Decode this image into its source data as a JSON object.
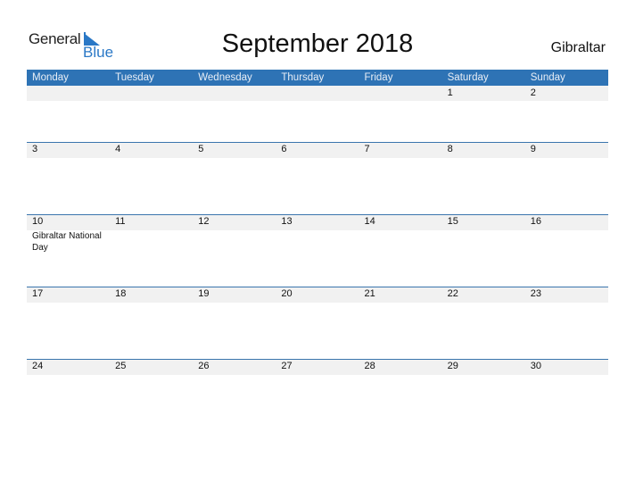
{
  "logo": {
    "text_primary": "General",
    "text_secondary": "Blue",
    "icon": "logo-triangle-icon",
    "accent_color": "#2a78c6"
  },
  "title": "September 2018",
  "country": "Gibraltar",
  "colors": {
    "header_bg": "#2e73b5",
    "row_shade": "#f1f1f1",
    "separator": "#3a75ad"
  },
  "weekdays": [
    "Monday",
    "Tuesday",
    "Wednesday",
    "Thursday",
    "Friday",
    "Saturday",
    "Sunday"
  ],
  "weeks": [
    {
      "days": [
        {
          "date": ""
        },
        {
          "date": ""
        },
        {
          "date": ""
        },
        {
          "date": ""
        },
        {
          "date": ""
        },
        {
          "date": "1"
        },
        {
          "date": "2"
        }
      ]
    },
    {
      "days": [
        {
          "date": "3"
        },
        {
          "date": "4"
        },
        {
          "date": "5"
        },
        {
          "date": "6"
        },
        {
          "date": "7"
        },
        {
          "date": "8"
        },
        {
          "date": "9"
        }
      ]
    },
    {
      "days": [
        {
          "date": "10",
          "event": "Gibraltar National Day"
        },
        {
          "date": "11"
        },
        {
          "date": "12"
        },
        {
          "date": "13"
        },
        {
          "date": "14"
        },
        {
          "date": "15"
        },
        {
          "date": "16"
        }
      ]
    },
    {
      "days": [
        {
          "date": "17"
        },
        {
          "date": "18"
        },
        {
          "date": "19"
        },
        {
          "date": "20"
        },
        {
          "date": "21"
        },
        {
          "date": "22"
        },
        {
          "date": "23"
        }
      ]
    },
    {
      "days": [
        {
          "date": "24"
        },
        {
          "date": "25"
        },
        {
          "date": "26"
        },
        {
          "date": "27"
        },
        {
          "date": "28"
        },
        {
          "date": "29"
        },
        {
          "date": "30"
        }
      ]
    }
  ]
}
